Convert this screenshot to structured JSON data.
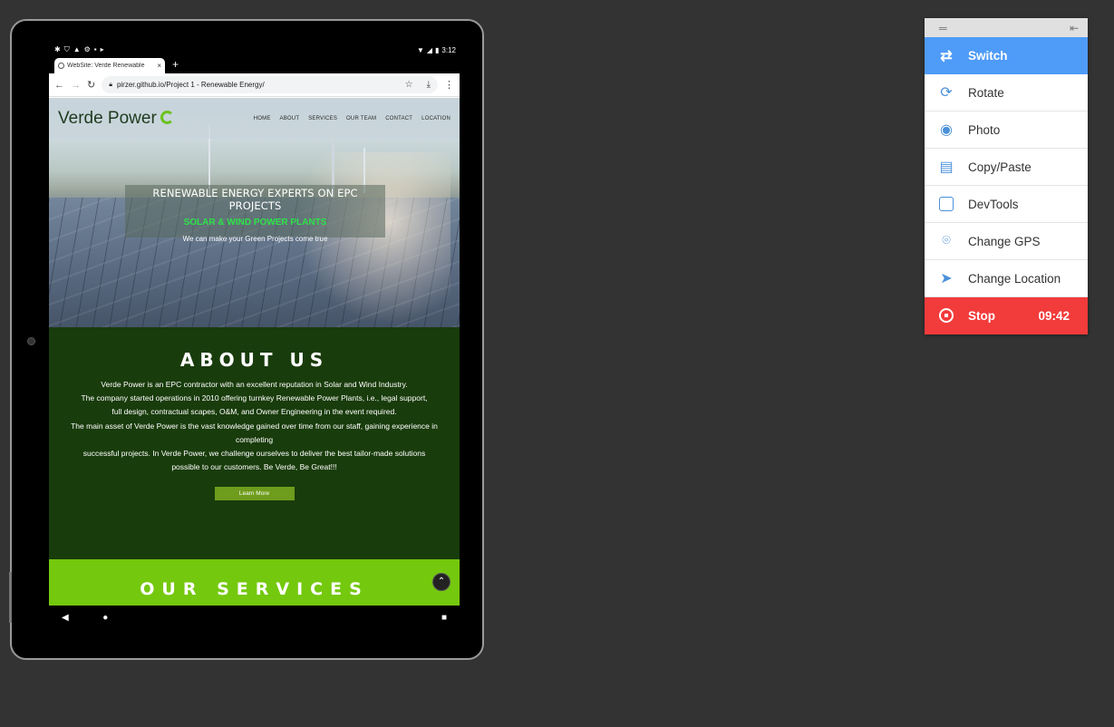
{
  "browser": {
    "status_time": "3:12",
    "tab_title": "WebSite: Verde Renewable",
    "tab_close": "×",
    "new_tab": "+",
    "url": "pirzer.github.io/Project 1 - Renewable Energy/"
  },
  "site": {
    "logo_text": "Verde Power",
    "nav": [
      "HOME",
      "ABOUT",
      "SERVICES",
      "OUR TEAM",
      "CONTACT",
      "LOCATION"
    ],
    "hero_title": "RENEWABLE ENERGY EXPERTS ON EPC PROJECTS",
    "hero_subtitle": "SOLAR & WIND POWER PLANTS",
    "hero_tagline": "We can make your Green Projects come true",
    "about_heading": "ABOUT US",
    "about_lines": [
      "Verde Power is an EPC contractor with an excellent reputation in Solar and Wind Industry.",
      "The company started operations in 2010 offering turnkey Renewable Power Plants, i.e., legal support,",
      "full design, contractual scapes, O&M, and Owner Engineering in the event required.",
      "The main asset of Verde Power is the vast knowledge gained over time from our staff, gaining experience in completing",
      "successful projects. In Verde Power, we challenge ourselves to deliver the best tailor-made solutions",
      "possible to our customers. Be Verde, Be Great!!!"
    ],
    "learn_more": "Learn More",
    "services_heading": "OUR SERVICES"
  },
  "tool_panel": {
    "items": [
      {
        "label": "Switch",
        "icon": "swap-arrows-icon"
      },
      {
        "label": "Rotate",
        "icon": "rotate-icon"
      },
      {
        "label": "Photo",
        "icon": "camera-icon"
      },
      {
        "label": "Copy/Paste",
        "icon": "clipboard-icon"
      },
      {
        "label": "DevTools",
        "icon": "code-window-icon"
      },
      {
        "label": "Change GPS",
        "icon": "map-pin-icon"
      },
      {
        "label": "Change Location",
        "icon": "navigation-arrow-icon"
      }
    ],
    "stop_label": "Stop",
    "timer": "09:42"
  },
  "colors": {
    "accent_blue": "#4e9bf8",
    "stop_red": "#f23b3b",
    "about_green": "#193c0c",
    "services_green": "#74c80e"
  }
}
